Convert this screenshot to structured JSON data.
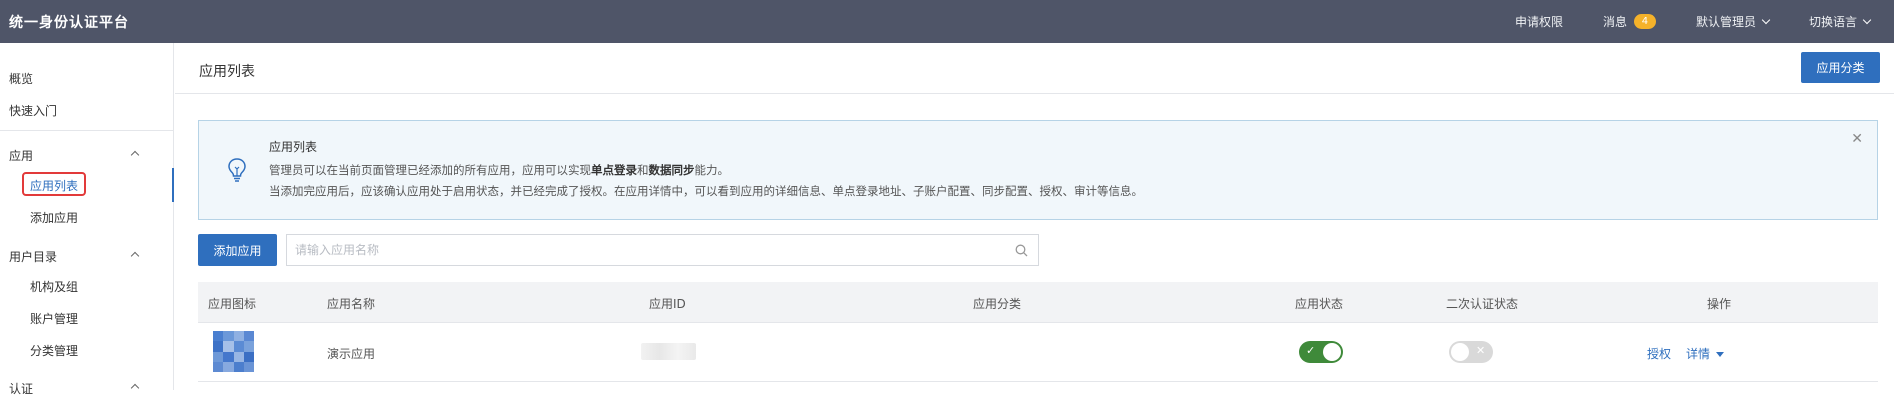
{
  "app": {
    "title": "统一身份认证平台"
  },
  "topnav": {
    "request_permission": "申请权限",
    "messages_label": "消息",
    "messages_count": "4",
    "admin_label": "默认管理员",
    "language_label": "切换语言"
  },
  "sidebar": {
    "overview": "概览",
    "quick_start": "快速入门",
    "groups": [
      {
        "label": "应用",
        "items": [
          "应用列表",
          "添加应用"
        ]
      },
      {
        "label": "用户目录",
        "items": [
          "机构及组",
          "账户管理",
          "分类管理"
        ]
      },
      {
        "label": "认证",
        "items": []
      }
    ],
    "active_item": "应用列表"
  },
  "page": {
    "title": "应用列表",
    "category_button": "应用分类"
  },
  "notice": {
    "title": "应用列表",
    "line1_prefix": "管理员可以在当前页面管理已经添加的所有应用，应用可以实现",
    "line1_bold1": "单点登录",
    "line1_mid": "和",
    "line1_bold2": "数据同步",
    "line1_suffix": "能力。",
    "line2": "当添加完应用后，应该确认应用处于启用状态，并已经完成了授权。在应用详情中，可以看到应用的详细信息、单点登录地址、子账户配置、同步配置、授权、审计等信息。"
  },
  "toolbar": {
    "add_button": "添加应用",
    "search_placeholder": "请输入应用名称"
  },
  "table": {
    "columns": [
      "应用图标",
      "应用名称",
      "应用ID",
      "应用分类",
      "应用状态",
      "二次认证状态",
      "操作"
    ],
    "rows": [
      {
        "name": "演示应用",
        "app_id": "",
        "category": "",
        "status_enabled": true,
        "mfa_enabled": false,
        "actions": [
          "授权",
          "详情"
        ]
      }
    ]
  },
  "colors": {
    "topbar": "#4f5568",
    "primary": "#2f6fbe",
    "toggle_on": "#3f8a3a",
    "toggle_off": "#d9d9d9",
    "badge": "#f5b22a",
    "highlight": "#e23a3a"
  }
}
